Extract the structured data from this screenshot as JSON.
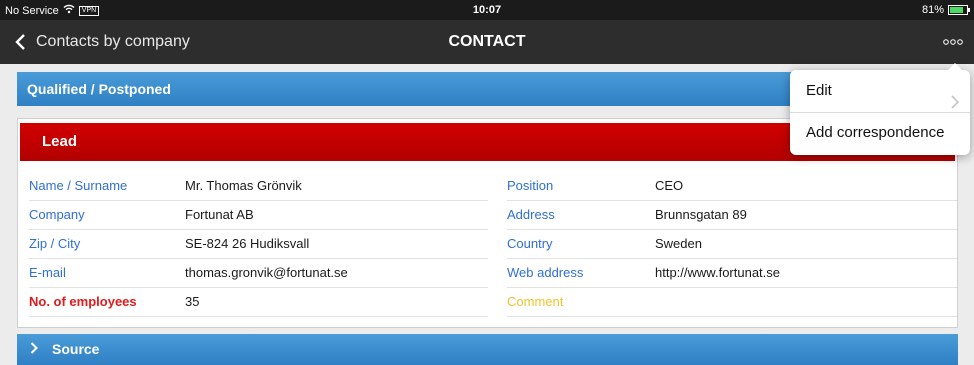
{
  "status_bar": {
    "carrier": "No Service",
    "vpn": "VPN",
    "time": "10:07",
    "battery_percent": "81%",
    "battery_level": 0.81
  },
  "nav": {
    "back_label": "Contacts by company",
    "title": "CONTACT",
    "more_icon": "more-icon"
  },
  "qualified": {
    "label": "Qualified / Postponed"
  },
  "lead": {
    "label": "Lead"
  },
  "fields_left": [
    {
      "label": "Name / Surname",
      "value": "Mr. Thomas Grönvik"
    },
    {
      "label": "Company",
      "value": "Fortunat AB"
    },
    {
      "label": "Zip / City",
      "value": "SE-824 26 Hudiksvall"
    },
    {
      "label": "E-mail",
      "value": "thomas.gronvik@fortunat.se"
    },
    {
      "label": "No. of employees",
      "value": "35"
    }
  ],
  "fields_right": [
    {
      "label": "Position",
      "value": "CEO"
    },
    {
      "label": "Address",
      "value": "Brunnsgatan 89"
    },
    {
      "label": "Country",
      "value": "Sweden"
    },
    {
      "label": "Web address",
      "value": "http://www.fortunat.se"
    },
    {
      "label": "Comment",
      "value": ""
    }
  ],
  "source": {
    "label": "Source"
  },
  "menu": {
    "items": [
      {
        "label": "Edit"
      },
      {
        "label": "Add correspondence"
      }
    ]
  },
  "colors": {
    "accent_blue": "#2f80c4",
    "lead_red": "#c00000",
    "label_blue": "#2f6fd6",
    "required_red": "#e11b1b",
    "comment_yellow": "#f3c22c"
  }
}
